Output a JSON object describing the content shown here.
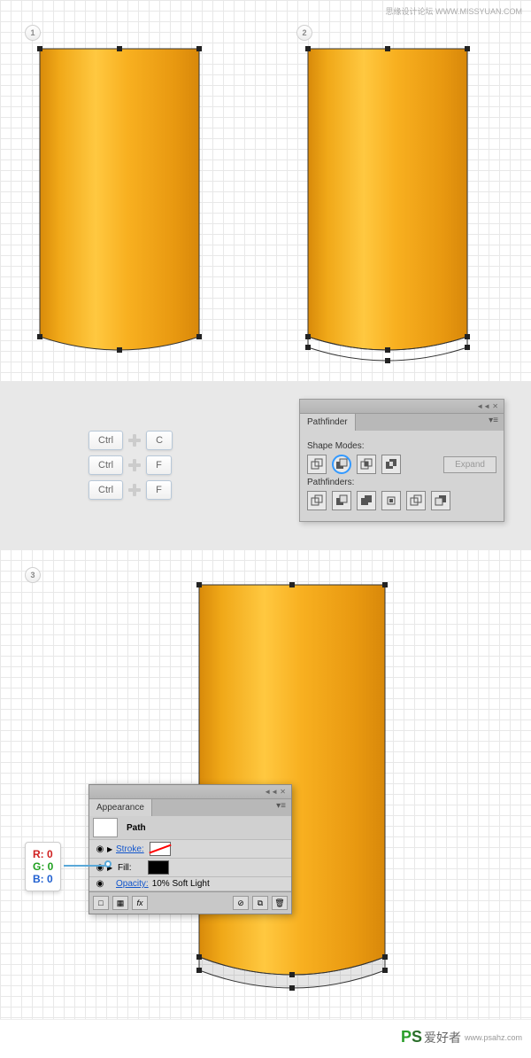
{
  "watermark": "思缘设计论坛 WWW.MISSYUAN.COM",
  "steps": {
    "s1": "1",
    "s2": "2",
    "s3": "3"
  },
  "shortcuts": [
    {
      "mod": "Ctrl",
      "key": "C"
    },
    {
      "mod": "Ctrl",
      "key": "F"
    },
    {
      "mod": "Ctrl",
      "key": "F"
    }
  ],
  "pathfinder": {
    "title": "Pathfinder",
    "shape_modes_label": "Shape Modes:",
    "pathfinders_label": "Pathfinders:",
    "expand": "Expand"
  },
  "appearance": {
    "title": "Appearance",
    "path": "Path",
    "stroke": "Stroke:",
    "fill": "Fill:",
    "opacity": "Opacity:",
    "opacity_val": "10% Soft Light",
    "fx": "fx"
  },
  "rgb": {
    "r": "R: 0",
    "g": "G: 0",
    "b": "B: 0"
  },
  "footer": {
    "brand": "PS",
    "tag": "爱好者",
    "url": "www.psahz.com"
  }
}
